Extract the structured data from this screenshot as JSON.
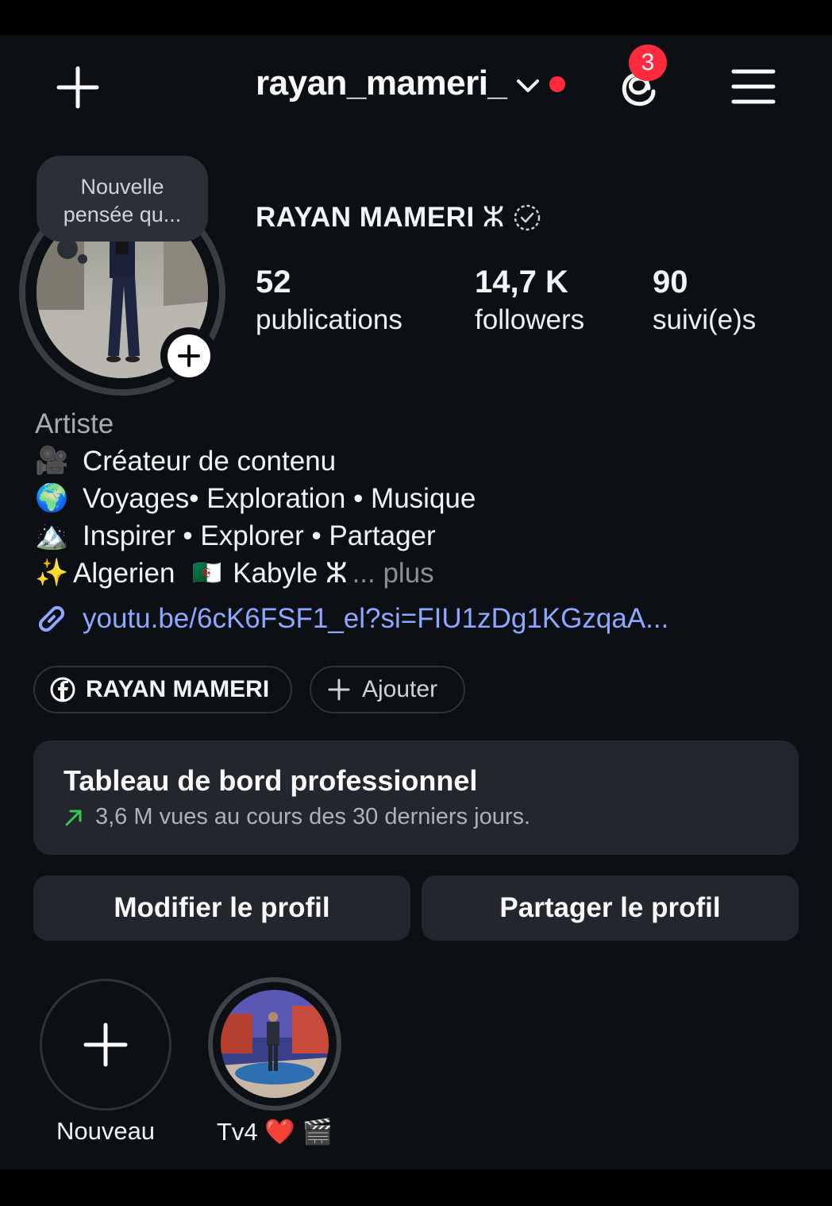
{
  "header": {
    "username": "rayan_mameri_",
    "notification_count": "3",
    "icons": [
      "plus-icon",
      "chevron-down-icon",
      "threads-icon",
      "menu-icon"
    ]
  },
  "profile": {
    "note_text": "Nouvelle pensée qu...",
    "full_name": "RAYAN MAMERI",
    "name_symbol": "ⵣ",
    "stats": [
      {
        "value": "52",
        "label": "publications"
      },
      {
        "value": "14,7 K",
        "label": "followers"
      },
      {
        "value": "90",
        "label": "suivi(e)s"
      }
    ]
  },
  "bio": {
    "category": "Artiste",
    "lines": [
      {
        "emoji": "🎥",
        "text": "Créateur de contenu"
      },
      {
        "emoji": "🌍",
        "text": "Voyages• Exploration • Musique"
      },
      {
        "emoji": "🏔️",
        "text": "Inspirer • Explorer • Partager"
      }
    ],
    "last_line": {
      "emoji": "✨",
      "text_a": "Algerien ",
      "flag": "🇩🇿",
      "text_b": " Kabyle ⵣ",
      "more": "... plus"
    },
    "link": "youtu.be/6cK6FSF1_el?si=FIU1zDg1KGzqaA..."
  },
  "pills": {
    "facebook": "RAYAN MAMERI",
    "add": "Ajouter"
  },
  "dashboard": {
    "title": "Tableau de bord professionnel",
    "subtitle": "3,6 M vues au cours des 30 derniers jours."
  },
  "buttons": {
    "edit": "Modifier le profil",
    "share": "Partager le profil"
  },
  "highlights": [
    {
      "label": "Nouveau"
    },
    {
      "label": "Tv4 ❤️ 🎬"
    }
  ],
  "colors": {
    "background": "#0c0f14",
    "accent_red": "#ff2a3d",
    "link": "#8fa8ff",
    "trend_green": "#34c759"
  }
}
